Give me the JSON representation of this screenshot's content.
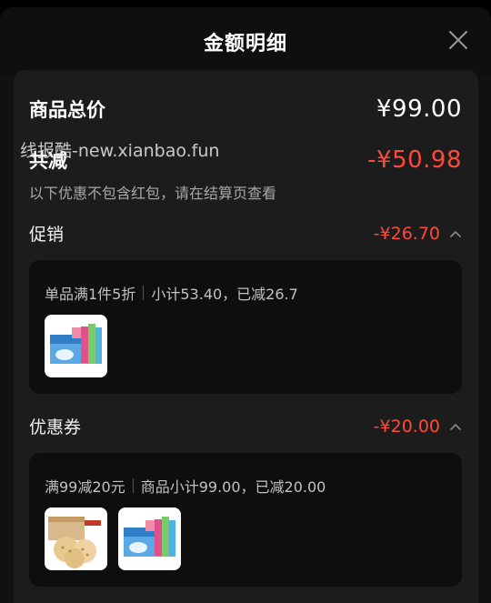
{
  "header": {
    "title": "金额明细",
    "close_icon": "close-icon"
  },
  "summary": {
    "total_label": "商品总价",
    "total_amount": "¥99.00",
    "discount_label": "共减",
    "discount_amount": "-¥50.98",
    "note": "以下优惠不包含红包，请在结算页查看"
  },
  "watermark": "线报酷-new.xianbao.fun",
  "promo": {
    "label": "促销",
    "amount": "-¥26.70",
    "rule": "单品满1件5折",
    "detail": "小计53.40，已减26.7",
    "items": [
      "milk-biscuit-box-thumbnail"
    ]
  },
  "coupon": {
    "label": "优惠券",
    "amount": "-¥20.00",
    "rule": "满99减20元",
    "detail": "商品小计99.00，已减20.00",
    "items": [
      "cracker-box-thumbnail",
      "milk-biscuit-box-thumbnail"
    ]
  },
  "colors": {
    "accent_red": "#ff4a3a",
    "background": "#000000",
    "panel": "#1c1c1c",
    "card": "#0e0e0e"
  }
}
